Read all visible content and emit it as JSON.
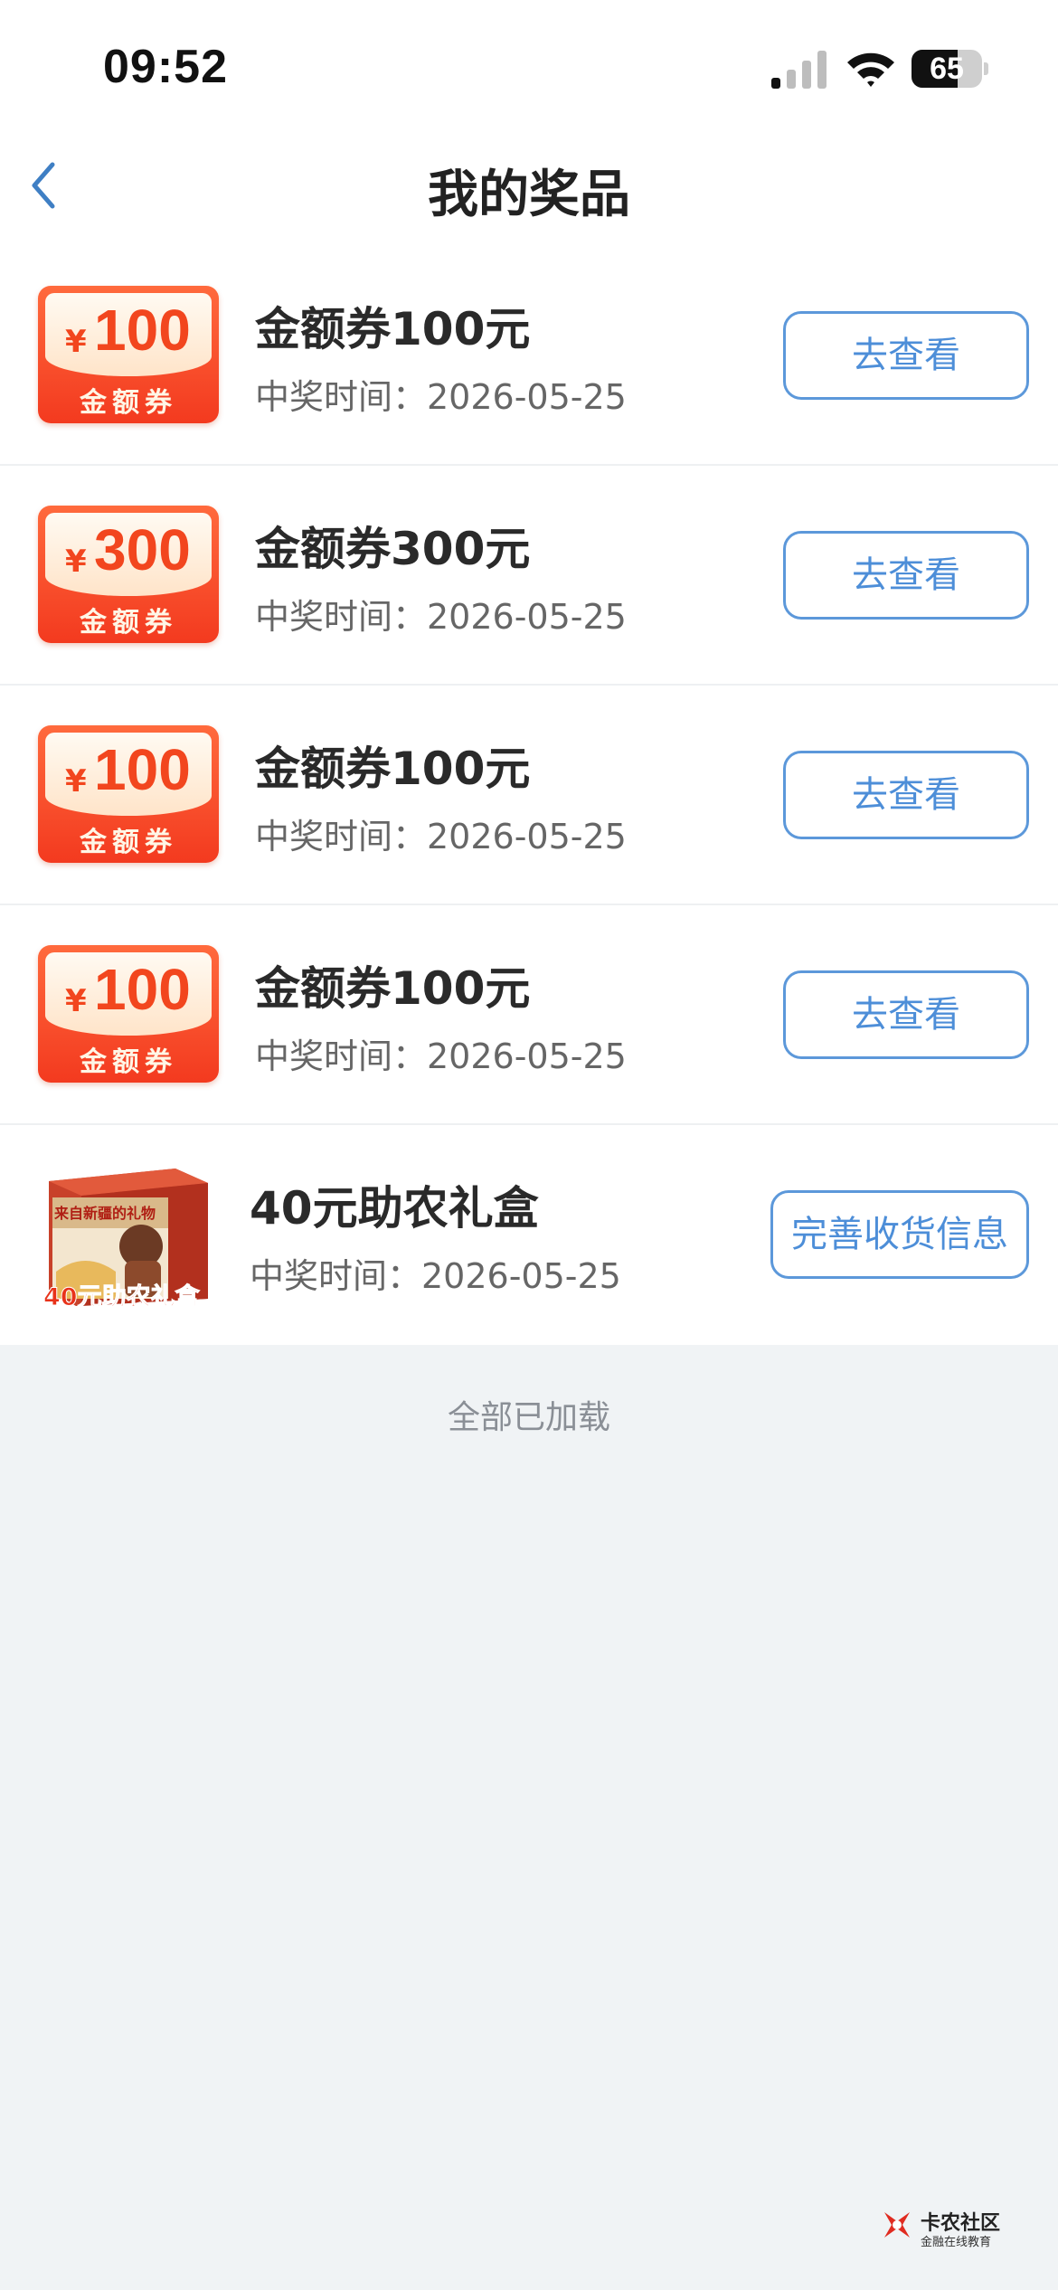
{
  "status_bar": {
    "time": "09:52",
    "battery": "65",
    "battery_level": 0.65
  },
  "nav": {
    "title": "我的奖品"
  },
  "prizes": [
    {
      "coupon_symbol": "¥",
      "coupon_amount": "100",
      "coupon_label": "金额券",
      "name": "金额券100元",
      "time": "中奖时间：2026-05-25",
      "action": "去查看"
    },
    {
      "coupon_symbol": "¥",
      "coupon_amount": "300",
      "coupon_label": "金额券",
      "name": "金额券300元",
      "time": "中奖时间：2026-05-25",
      "action": "去查看"
    },
    {
      "coupon_symbol": "¥",
      "coupon_amount": "100",
      "coupon_label": "金额券",
      "name": "金额券100元",
      "time": "中奖时间：2026-05-25",
      "action": "去查看"
    },
    {
      "coupon_symbol": "¥",
      "coupon_amount": "100",
      "coupon_label": "金额券",
      "name": "金额券100元",
      "time": "中奖时间：2026-05-25",
      "action": "去查看"
    },
    {
      "gift_banner": "来自新疆的礼物",
      "gift_caption": "40元助农礼盒",
      "name": "40元助农礼盒",
      "time": "中奖时间：2026-05-25",
      "action": "完善收货信息"
    }
  ],
  "footer": {
    "text": "全部已加载"
  },
  "watermark": {
    "name": "卡农社区",
    "sub": "金融在线教育"
  },
  "colors": {
    "accent": "#4d8ed8",
    "coupon_red": "#f33a1f",
    "background": "#f0f3f5"
  }
}
